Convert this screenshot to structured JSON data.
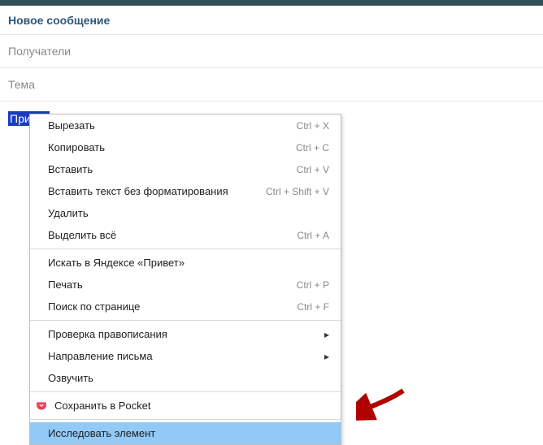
{
  "header": {
    "title": "Новое сообщение"
  },
  "fields": {
    "recipients_placeholder": "Получатели",
    "subject_placeholder": "Тема"
  },
  "body": {
    "selected_text": "Привет"
  },
  "context_menu": {
    "cut": {
      "label": "Вырезать",
      "shortcut": "Ctrl + X"
    },
    "copy": {
      "label": "Копировать",
      "shortcut": "Ctrl + C"
    },
    "paste": {
      "label": "Вставить",
      "shortcut": "Ctrl + V"
    },
    "paste_plain": {
      "label": "Вставить текст без форматирования",
      "shortcut": "Ctrl + Shift + V"
    },
    "delete": {
      "label": "Удалить",
      "shortcut": ""
    },
    "select_all": {
      "label": "Выделить всё",
      "shortcut": "Ctrl + A"
    },
    "search_yandex": {
      "label": "Искать в Яндексе «Привет»",
      "shortcut": ""
    },
    "print": {
      "label": "Печать",
      "shortcut": "Ctrl + P"
    },
    "find": {
      "label": "Поиск по странице",
      "shortcut": "Ctrl + F"
    },
    "spellcheck": {
      "label": "Проверка правописания"
    },
    "direction": {
      "label": "Направление письма"
    },
    "speak": {
      "label": "Озвучить"
    },
    "pocket": {
      "label": "Сохранить в Pocket"
    },
    "inspect": {
      "label": "Исследовать элемент"
    }
  }
}
